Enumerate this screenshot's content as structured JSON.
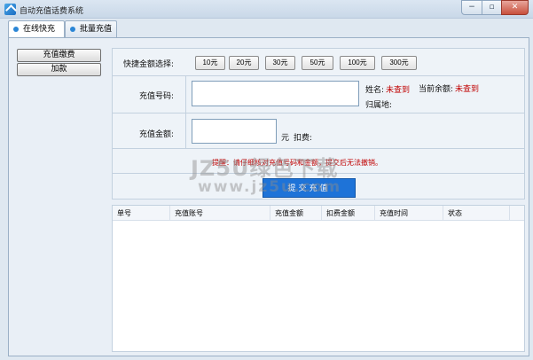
{
  "window": {
    "title": "自动充值话费系统",
    "min_label": "−",
    "max_label": "▫",
    "close_label": "✕"
  },
  "tabs": [
    {
      "label": "在线快充",
      "active": true
    },
    {
      "label": "批量充值",
      "active": false
    }
  ],
  "sidebar": {
    "items": [
      {
        "label": "充值缴费"
      },
      {
        "label": "加款"
      }
    ]
  },
  "form": {
    "quick_amount_label": "快捷金额选择:",
    "quick_amounts": [
      "10元",
      "20元",
      "30元",
      "50元",
      "100元",
      "300元"
    ],
    "phone_label": "充值号码:",
    "phone_value": "",
    "name_label": "姓名:",
    "name_value": "未查到",
    "balance_label": "当前余额:",
    "balance_value": "未查到",
    "region_label": "归属地:",
    "amount_label": "充值金额:",
    "amount_value": "",
    "unit_label": "元",
    "deduct_label": "扣费:",
    "notice": "提醒：请仔细核对充值号码和金额，提交后无法撤销。",
    "submit_label": "提交充值"
  },
  "watermark": {
    "line1": "JZ5U绿色下载",
    "line2": "www.jz5u.com"
  },
  "table": {
    "columns": [
      "单号",
      "充值账号",
      "充值金额",
      "扣费金额",
      "充值时间",
      "状态"
    ],
    "rows": []
  },
  "colors": {
    "accent": "#1e73d8",
    "warning": "#c00000"
  }
}
